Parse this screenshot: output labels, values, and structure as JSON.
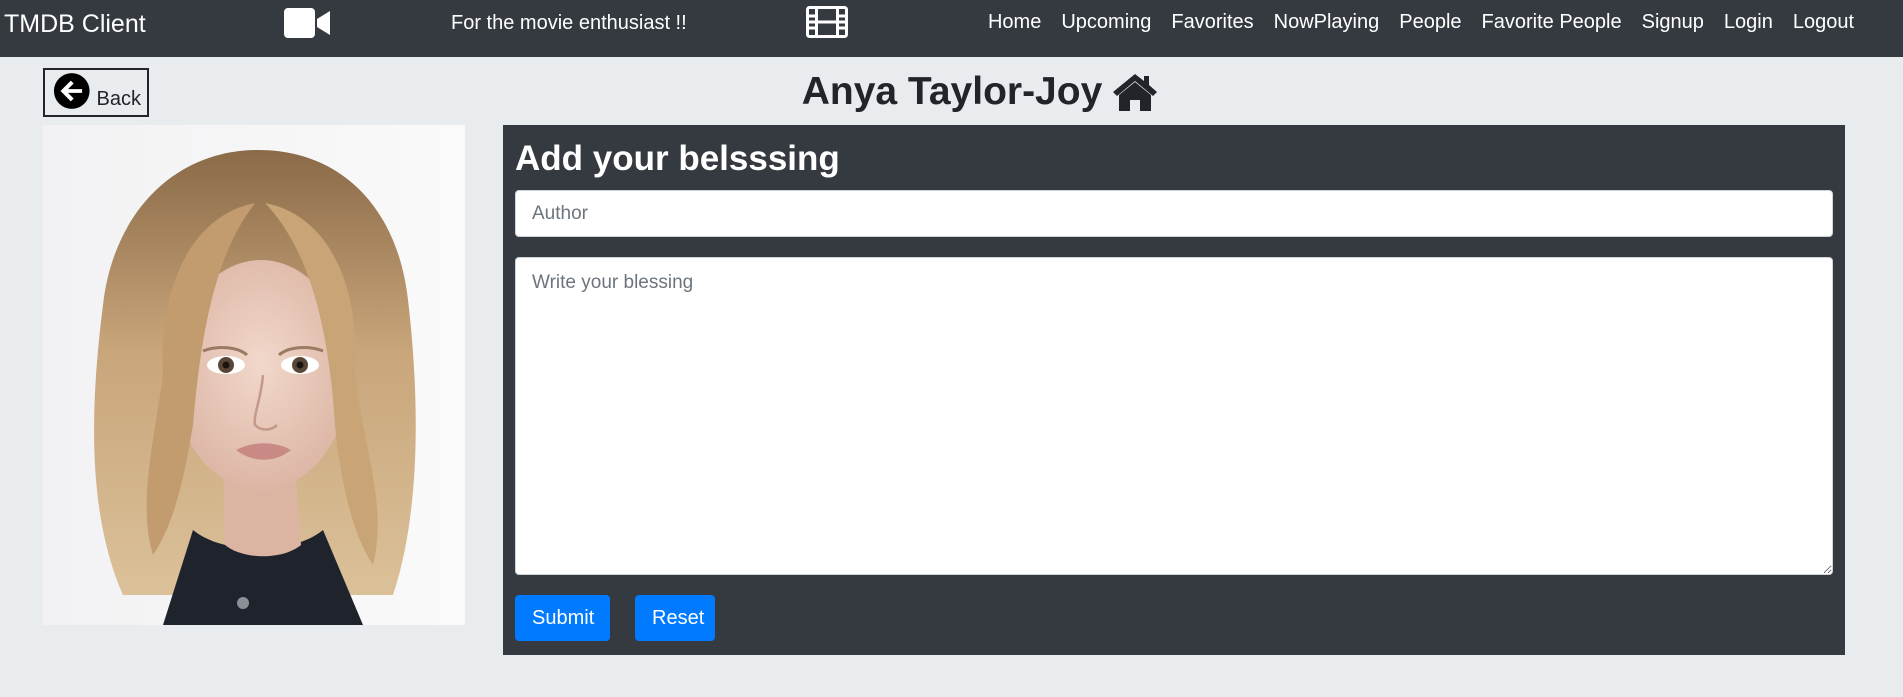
{
  "navbar": {
    "brand": "TMDB Client",
    "tagline": "For the movie enthusiast !!",
    "video_icon": "video-camera-icon",
    "film_icon": "film-icon",
    "links": [
      "Home",
      "Upcoming",
      "Favorites",
      "NowPlaying",
      "People",
      "Favorite People",
      "Signup",
      "Login",
      "Logout"
    ]
  },
  "back": {
    "label": "Back",
    "icon": "arrow-left-circle-icon"
  },
  "page": {
    "title": "Anya Taylor-Joy",
    "title_icon": "home-icon"
  },
  "form": {
    "heading": "Add your belsssing",
    "author_placeholder": "Author",
    "author_value": "",
    "blessing_placeholder": "Write your blessing",
    "blessing_value": "",
    "submit_label": "Submit",
    "reset_label": "Reset"
  },
  "colors": {
    "navbar_bg": "#343a40",
    "page_bg": "#e9ecef",
    "panel_bg": "#343a40",
    "primary": "#007bff"
  }
}
